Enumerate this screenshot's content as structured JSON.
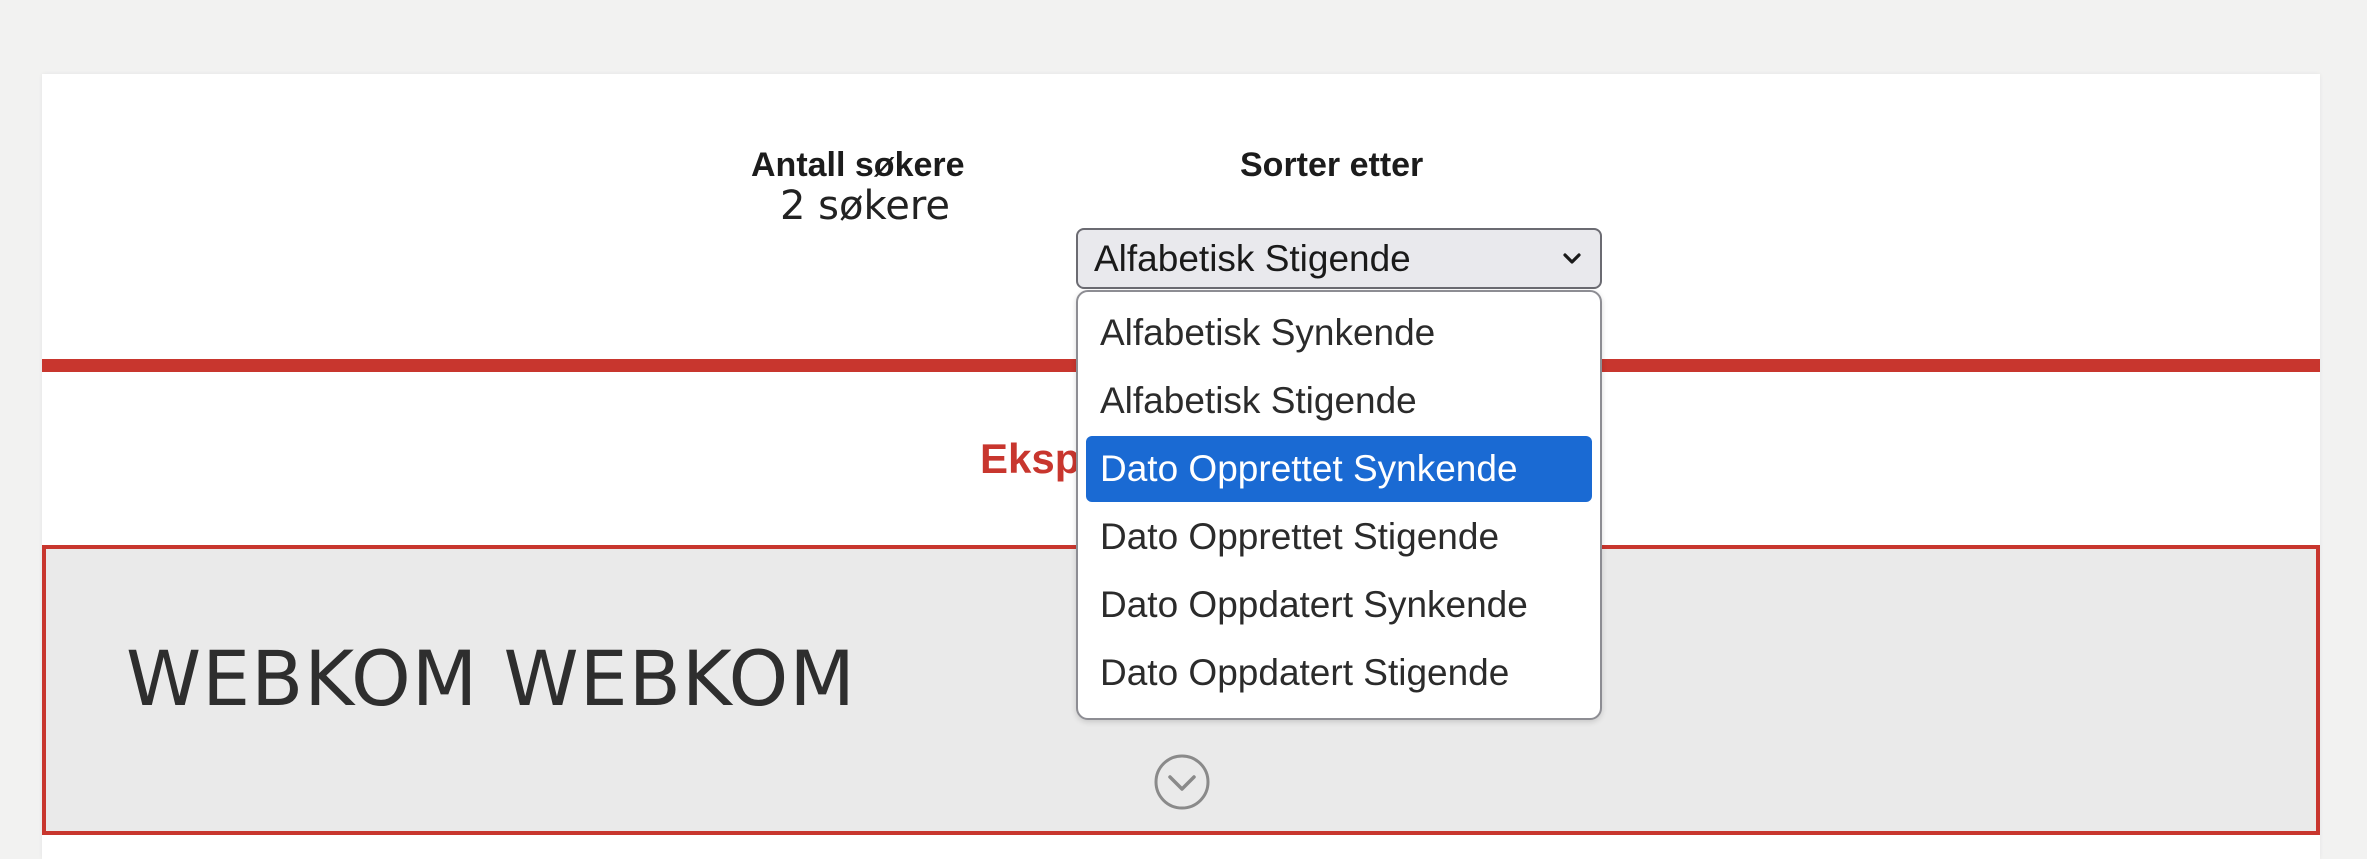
{
  "stats": {
    "count_label": "Antall søkere",
    "count_value": "2 søkere"
  },
  "sort": {
    "label": "Sorter etter",
    "selected": "Alfabetisk Stigende",
    "options": [
      "Alfabetisk Synkende",
      "Alfabetisk Stigende",
      "Dato Opprettet Synkende",
      "Dato Opprettet Stigende",
      "Dato Oppdatert Synkende",
      "Dato Oppdatert Stigende"
    ],
    "highlighted_option": "Dato Opprettet Synkende"
  },
  "export": {
    "visible_text": "Eksp"
  },
  "applicants": [
    {
      "name": "WEBKOM WEBKOM"
    }
  ],
  "icons": {
    "select": "chevron-down-icon",
    "expand": "circle-chevron-down-icon"
  },
  "colors": {
    "accent_red": "#c8362e",
    "highlight_blue": "#1a6ad3",
    "card_bg": "#eaeaea",
    "page_bg": "#f2f2f1"
  }
}
